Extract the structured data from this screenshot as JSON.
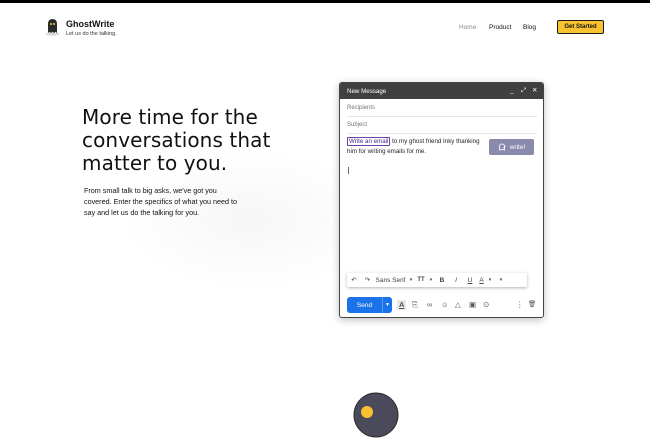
{
  "brand": {
    "name": "GhostWrite",
    "tagline": "Let us do the talking."
  },
  "nav": {
    "home": "Home",
    "product": "Product",
    "blog": "Blog",
    "cta": "Get Started"
  },
  "hero": {
    "title": "More time for the conversations that matter to you.",
    "subtitle": "From small talk to big asks, we've got you covered. Enter the specifics of what you need to say and let us do the talking for you."
  },
  "compose": {
    "title": "New Message",
    "controls": {
      "minimize": "_",
      "expand": "⤢",
      "close": "✕"
    },
    "recipients_placeholder": "Recipients",
    "subject_placeholder": "Subject",
    "highlighted_prompt": "Write an email",
    "body_rest": " to my ghost friend Inky thanking him for writing emails for me.",
    "write_button": "write!",
    "format": {
      "undo": "↶",
      "redo": "↷",
      "font": "Sans Serif",
      "font_caret": "▾",
      "size": "TT",
      "size_caret": "▾",
      "bold": "B",
      "italic": "I",
      "underline": "U",
      "color": "A",
      "color_caret": "▾",
      "more_caret": "▾"
    },
    "send": "Send",
    "send_more": "▼",
    "tools": {
      "format_text": "A",
      "attach": "⎘",
      "link": "∞",
      "emoji": "☺",
      "drive": "△",
      "photo": "▣",
      "lock": "⊙",
      "more": "⋮",
      "trash": "🗑"
    }
  },
  "colors": {
    "accent": "#f9c22e",
    "send": "#1a73e8",
    "write_button": "#8a8aad",
    "header": "#404040",
    "highlight_border": "#6e3fa8"
  }
}
